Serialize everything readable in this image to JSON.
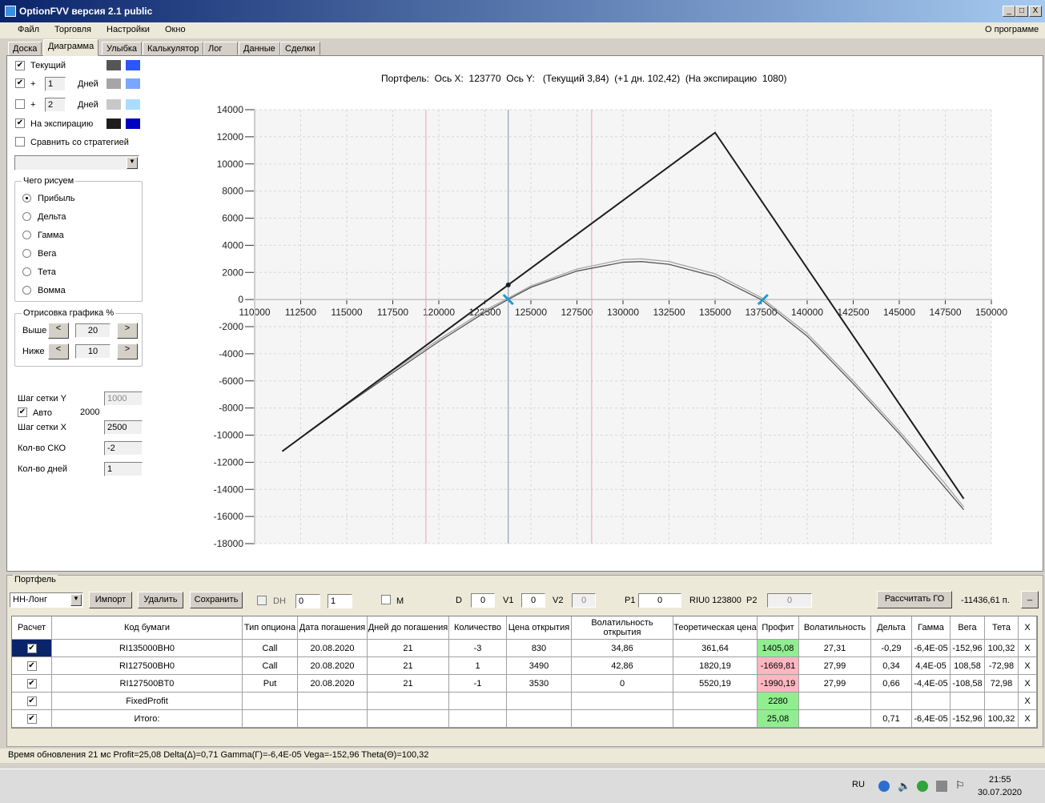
{
  "window": {
    "title": "OptionFVV версия 2.1 public",
    "min": "_",
    "max": "□",
    "close": "X"
  },
  "menu": {
    "items": [
      "Файл",
      "Торговля",
      "Настройки",
      "Окно"
    ],
    "about": "О программе"
  },
  "tabs": [
    "Доска",
    "Диаграмма",
    "Улыбка",
    "Калькулятор",
    "Лог",
    "Данные",
    "Сделки"
  ],
  "active_tab": "Диаграмма",
  "left": {
    "current": {
      "label": "Текущий",
      "checked": true,
      "colors": [
        "#555555",
        "#2a55ff"
      ]
    },
    "plus1": {
      "plus": "+",
      "days": "1",
      "label": "Дней",
      "checked": true,
      "colors": [
        "#a6a6a6",
        "#7aa6ff"
      ]
    },
    "plus2": {
      "plus": "+",
      "days": "2",
      "label": "Дней",
      "checked": false,
      "colors": [
        "#c8c8c8",
        "#aadcff"
      ]
    },
    "expiry": {
      "label": "На экспирацию",
      "checked": true,
      "colors": [
        "#1e1e1e",
        "#0000c0"
      ]
    },
    "compare": {
      "label": "Сравнить со стратегией",
      "checked": false
    },
    "draw_group": {
      "title": "Чего рисуем",
      "options": [
        "Прибыль",
        "Дельта",
        "Гамма",
        "Вега",
        "Тета",
        "Вомма"
      ],
      "selected": 0
    },
    "render_group": {
      "title": "Отрисовка графика %",
      "above_label": "Выше",
      "above": "20",
      "below_label": "Ниже",
      "below": "10",
      "prev": "<",
      "next": ">"
    },
    "grid_y_label": "Шаг сетки Y",
    "grid_y": "1000",
    "auto_label": "Авто",
    "auto_checked": true,
    "auto_value": "2000",
    "grid_x_label": "Шаг сетки X",
    "grid_x": "2500",
    "sko_label": "Кол-во СКО",
    "sko": "-2",
    "days_label": "Кол-во дней",
    "days": "1"
  },
  "chart_header": "Портфель:  Ось X:  123770  Ось Y:   (Текущий 3,84)  (+1 дн. 102,42)  (На экспирацию  1080)",
  "chart_data": {
    "type": "line",
    "xlim": [
      110000,
      150000
    ],
    "ylim": [
      -18000,
      14000
    ],
    "xticks": [
      110000,
      112500,
      115000,
      117500,
      120000,
      122500,
      125000,
      127500,
      130000,
      132500,
      135000,
      137500,
      140000,
      142500,
      145000,
      147500,
      150000
    ],
    "yticks": [
      14000,
      12000,
      10000,
      8000,
      6000,
      4000,
      2000,
      0,
      -2000,
      -4000,
      -6000,
      -8000,
      -10000,
      -12000,
      -14000,
      -16000,
      -18000
    ],
    "grid": true,
    "cursor_x": 123770,
    "markers_red": [
      119300,
      128300
    ],
    "breakeven_marks": [
      123770,
      137600
    ],
    "series": [
      {
        "name": "На экспирацию",
        "color": "#1e1e1e",
        "points": [
          [
            111500,
            -11190
          ],
          [
            135000,
            12310
          ],
          [
            148500,
            -14690
          ]
        ]
      },
      {
        "name": "+1 дн.",
        "color": "#a6a6a6",
        "points": [
          [
            111500,
            -11190
          ],
          [
            115000,
            -7700
          ],
          [
            117500,
            -5250
          ],
          [
            120000,
            -2950
          ],
          [
            122500,
            -800
          ],
          [
            123770,
            102
          ],
          [
            125000,
            1000
          ],
          [
            127500,
            2250
          ],
          [
            130000,
            2950
          ],
          [
            131000,
            3000
          ],
          [
            132500,
            2800
          ],
          [
            135000,
            1900
          ],
          [
            137500,
            150
          ],
          [
            140000,
            -2500
          ],
          [
            142500,
            -6000
          ],
          [
            145000,
            -9700
          ],
          [
            147500,
            -13600
          ],
          [
            148500,
            -15300
          ]
        ]
      },
      {
        "name": "Текущий",
        "color": "#555555",
        "points": [
          [
            111500,
            -11190
          ],
          [
            115000,
            -7750
          ],
          [
            117500,
            -5400
          ],
          [
            120000,
            -3100
          ],
          [
            122500,
            -950
          ],
          [
            123770,
            4
          ],
          [
            125000,
            900
          ],
          [
            127500,
            2100
          ],
          [
            130000,
            2750
          ],
          [
            131000,
            2800
          ],
          [
            132500,
            2600
          ],
          [
            135000,
            1700
          ],
          [
            137500,
            0
          ],
          [
            140000,
            -2700
          ],
          [
            142500,
            -6200
          ],
          [
            145000,
            -9900
          ],
          [
            147500,
            -13900
          ],
          [
            148500,
            -15500
          ]
        ]
      }
    ]
  },
  "portfolio": {
    "title": "Портфель",
    "name": "НН-Лонг",
    "import": "Импорт",
    "delete": "Удалить",
    "save": "Сохранить",
    "dh_label": "DH",
    "dh1": "0",
    "dh2": "1",
    "m_label": "M",
    "d_label": "D",
    "d": "0",
    "v1_label": "V1",
    "v1": "0",
    "v2_label": "V2",
    "v2": "0",
    "p1_label": "P1",
    "p1": "0",
    "riu": "RIU0 123800",
    "p2_label": "P2",
    "p2": "0",
    "calc_go": "Рассчитать ГО",
    "go_value": "-11436,61 п.",
    "collapse": "_"
  },
  "table": {
    "headers": [
      "Расчет",
      "Код бумаги",
      "Тип опциона",
      "Дата погашения",
      "Дней до погашения",
      "Количество",
      "Цена открытия",
      "Волатильность открытия",
      "Теоретическая цена",
      "Профит",
      "Волатильность",
      "Дельта",
      "Гамма",
      "Вега",
      "Тета",
      "X"
    ],
    "rows": [
      [
        "✔",
        "RI135000BH0",
        "Call",
        "20.08.2020",
        "21",
        "-3",
        "830",
        "34,86",
        "361,64",
        "1405,08",
        "27,31",
        "-0,29",
        "-6,4E-05",
        "-152,96",
        "100,32",
        "X"
      ],
      [
        "✔",
        "RI127500BH0",
        "Call",
        "20.08.2020",
        "21",
        "1",
        "3490",
        "42,86",
        "1820,19",
        "-1669,81",
        "27,99",
        "0,34",
        "4,4E-05",
        "108,58",
        "-72,98",
        "X"
      ],
      [
        "✔",
        "RI127500BT0",
        "Put",
        "20.08.2020",
        "21",
        "-1",
        "3530",
        "0",
        "5520,19",
        "-1990,19",
        "27,99",
        "0,66",
        "-4,4E-05",
        "-108,58",
        "72,98",
        "X"
      ],
      [
        "✔",
        "FixedProfit",
        "",
        "",
        "",
        "",
        "",
        "",
        "",
        "2280",
        "",
        "",
        "",
        "",
        "",
        "X"
      ],
      [
        "✔",
        "Итого:",
        "",
        "",
        "",
        "",
        "",
        "",
        "",
        "25,08",
        "",
        "0,71",
        "-6,4E-05",
        "-152,96",
        "100,32",
        "X"
      ]
    ],
    "profit_status": [
      "green",
      "red",
      "red",
      "green",
      "green"
    ]
  },
  "status": "Время обновления 21 мс  Profit=25,08 Delta(Δ)=0,71 Gamma(Γ)=-6,4E-05 Vega=-152,96 Theta(Θ)=100,32",
  "taskbar": {
    "lang": "RU",
    "time": "21:55",
    "date": "30.07.2020"
  }
}
